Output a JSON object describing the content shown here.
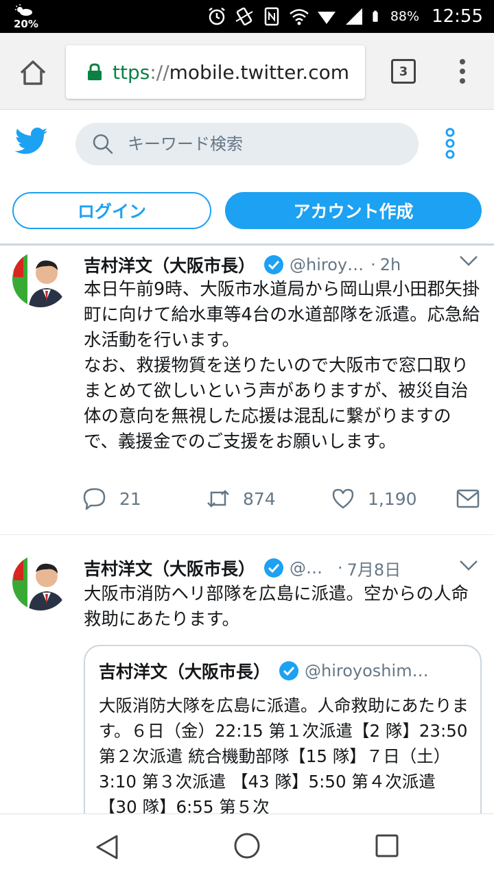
{
  "status_bar": {
    "temperature": "20%",
    "battery": "88%",
    "time": "12:55"
  },
  "browser": {
    "url_scheme": "ttps",
    "url_sep": "://",
    "url_host": "mobile.twitter.com",
    "tab_count": "3"
  },
  "header": {
    "search_placeholder": "キーワード検索",
    "login_label": "ログイン",
    "signup_label": "アカウント作成"
  },
  "tweets": [
    {
      "name": "吉村洋文（大阪市長）",
      "handle": "@hiroy…",
      "time": "2h",
      "text": "本日午前9時、大阪市水道局から岡山県小田郡矢掛町に向けて給水車等4台の水道部隊を派遣。応急給水活動を行います。\nなお、救援物質を送りたいので大阪市で窓口取りまとめて欲しいという声がありますが、被災自治体の意向を無視した応援は混乱に繋がりますので、義援金でのご支援をお願いします。",
      "replies": "21",
      "retweets": "874",
      "likes": "1,190"
    },
    {
      "name": "吉村洋文（大阪市長）",
      "handle": "@…",
      "time": "7月8日",
      "text": "大阪市消防ヘリ部隊を広島に派遣。空からの人命救助にあたります。",
      "quote": {
        "name": "吉村洋文（大阪市長）",
        "handle": "@hiroyoshim…",
        "text": "大阪消防大隊を広島に派遣。人命救助にあたります。６日（金）22:15 第１次派遣【2 隊】23:50 第２次派遣 統合機動部隊【15 隊】７日（土）3:10 第３次派遣 【43 隊】5:50 第４次派遣 【30 隊】6:55 第５次"
      }
    }
  ],
  "colors": {
    "twitter_blue": "#1da1f2",
    "secure_green": "#0b8043",
    "muted_text": "#657786"
  }
}
